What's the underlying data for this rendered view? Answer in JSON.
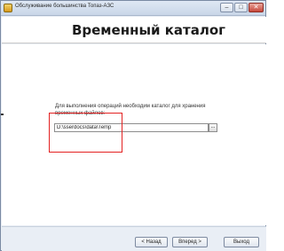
{
  "window": {
    "title": "Обслуживание большинства Топаз-АЗС",
    "icons": {
      "app": "app-icon",
      "minimize": "minimize-icon",
      "maximize": "maximize-icon",
      "close": "close-icon"
    }
  },
  "header": {
    "title": "Временный каталог"
  },
  "main": {
    "description": "Для выполнения операций необходим каталог для хранения временных файлов:",
    "path_value": "D:\\sserdocs\\data\\Temp",
    "browse_label": "...",
    "highlight_color": "#e32222"
  },
  "footer": {
    "back_label": "< Назад",
    "next_label": "Вперед >",
    "exit_label": "Выход"
  }
}
